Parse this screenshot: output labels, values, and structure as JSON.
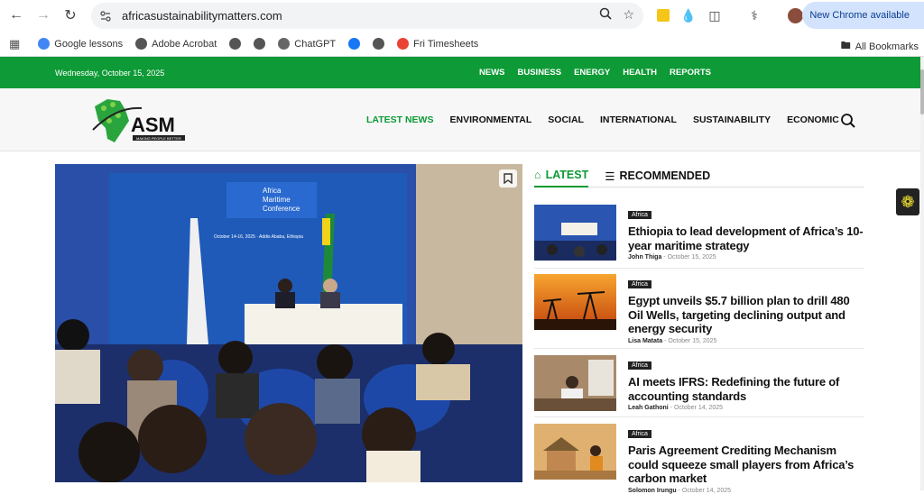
{
  "browser": {
    "url": "africasustainabilitymatters.com",
    "new_chrome_label": "New Chrome available",
    "bookmarks": [
      "Google lessons",
      "Adobe Acrobat",
      "ChatGPT",
      "Fri Timesheets"
    ],
    "all_bookmarks_label": "All Bookmarks"
  },
  "site": {
    "date": "Wednesday, October 15, 2025",
    "topnav": [
      "NEWS",
      "BUSINESS",
      "ENERGY",
      "HEALTH",
      "REPORTS"
    ],
    "logo_text": "ASM",
    "logo_tagline": "MAKING PEOPLE BETTER",
    "mainnav": [
      "LATEST NEWS",
      "ENVIRONMENTAL",
      "SOCIAL",
      "INTERNATIONAL",
      "SUSTAINABILITY",
      "ECONOMIC"
    ],
    "accent": "#0e9a36"
  },
  "hero": {
    "banner_line1": "Africa",
    "banner_line2": "Maritime",
    "banner_line3": "Conference",
    "banner_date": "October 14-16, 2025 · Addis Ababa, Ethiopia"
  },
  "tabs": {
    "latest": "LATEST",
    "recommended": "RECOMMENDED"
  },
  "articles": [
    {
      "category": "Africa",
      "title": "Ethiopia to lead development of Africa’s 10-year maritime strategy",
      "author": "John Thiga",
      "date": "October 15, 2025"
    },
    {
      "category": "Africa",
      "title": "Egypt unveils $5.7 billion plan to drill 480 Oil Wells, targeting declining output and energy security",
      "author": "Lisa Matata",
      "date": "October 15, 2025"
    },
    {
      "category": "Africa",
      "title": "AI meets IFRS: Redefining the future of accounting standards",
      "author": "Leah Gathoni",
      "date": "October 14, 2025"
    },
    {
      "category": "Africa",
      "title": "Paris Agreement Crediting Mechanism could squeeze small players from Africa’s carbon market",
      "author": "Solomon Irungu",
      "date": "October 14, 2025"
    }
  ]
}
